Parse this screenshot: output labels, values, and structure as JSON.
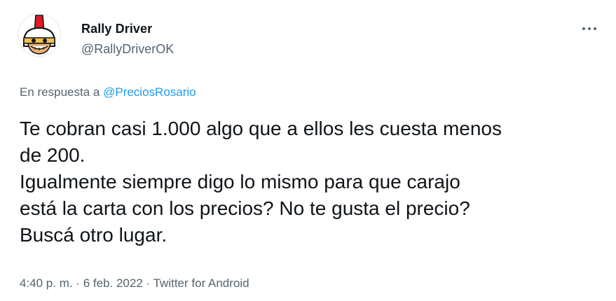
{
  "author": {
    "name": "Rally Driver",
    "handle": "@RallyDriverOK",
    "avatar": "cartoon-helmet-avatar"
  },
  "reply": {
    "prefix": "En respuesta a",
    "mention": "@PreciosRosario"
  },
  "tweet": {
    "text": "Te cobran casi 1.000 algo que a ellos les cuesta menos\nde 200.\nIgualmente siempre digo lo mismo  para que carajo\nestá la carta con los precios? No te gusta el precio?\nBuscá otro lugar."
  },
  "meta": {
    "time": "4:40 p. m.",
    "separator1": " · ",
    "date": "6 feb. 2022",
    "separator2": " · ",
    "source": "Twitter for Android"
  },
  "menu": {
    "icon": "more-horizontal-icon"
  },
  "colors": {
    "text": "#0f1419",
    "secondary": "#536471",
    "link": "#1d9bf0"
  }
}
